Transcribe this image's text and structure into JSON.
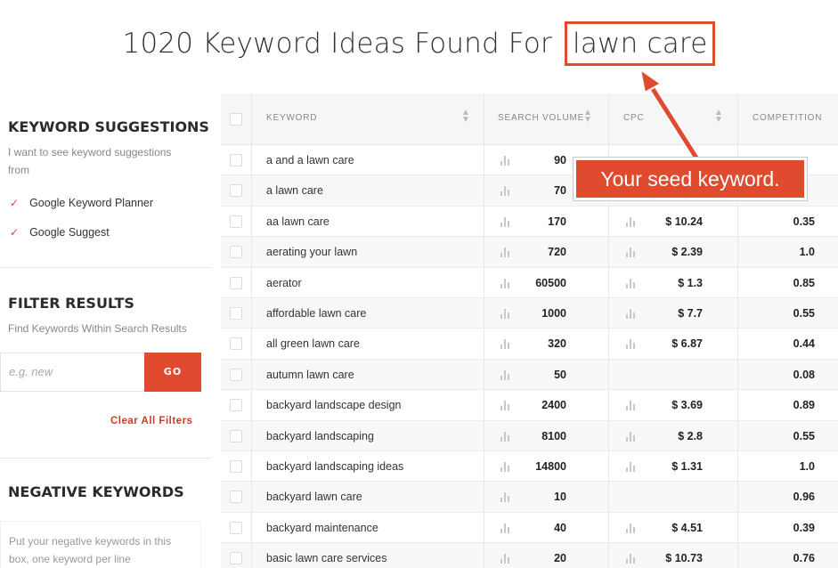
{
  "title": {
    "prefix": "1020 Keyword Ideas Found For",
    "seed": "lawn care"
  },
  "callout": {
    "text": "Your seed keyword."
  },
  "sidebar": {
    "suggestions": {
      "heading": "KEYWORD SUGGESTIONS",
      "description": "I want to see keyword suggestions from",
      "sources": [
        {
          "label": "Google Keyword Planner",
          "checked": true
        },
        {
          "label": "Google Suggest",
          "checked": true
        }
      ]
    },
    "filter": {
      "heading": "FILTER RESULTS",
      "description": "Find Keywords Within Search Results",
      "placeholder": "e.g. new",
      "go_label": "GO",
      "clear_label": "Clear All Filters"
    },
    "negative": {
      "heading": "NEGATIVE KEYWORDS",
      "placeholder": "Put your negative keywords in this box, one keyword per line"
    }
  },
  "table": {
    "headers": {
      "keyword": "KEYWORD",
      "volume": "SEARCH VOLUME",
      "cpc": "CPC",
      "competition": "COMPETITION"
    },
    "rows": [
      {
        "keyword": "a and a lawn care",
        "volume": "90",
        "cpc": "",
        "competition": ""
      },
      {
        "keyword": "a lawn care",
        "volume": "70",
        "cpc": "",
        "competition": ""
      },
      {
        "keyword": "aa lawn care",
        "volume": "170",
        "cpc": "$ 10.24",
        "competition": "0.35"
      },
      {
        "keyword": "aerating your lawn",
        "volume": "720",
        "cpc": "$ 2.39",
        "competition": "1.0"
      },
      {
        "keyword": "aerator",
        "volume": "60500",
        "cpc": "$ 1.3",
        "competition": "0.85"
      },
      {
        "keyword": "affordable lawn care",
        "volume": "1000",
        "cpc": "$ 7.7",
        "competition": "0.55"
      },
      {
        "keyword": "all green lawn care",
        "volume": "320",
        "cpc": "$ 6.87",
        "competition": "0.44"
      },
      {
        "keyword": "autumn lawn care",
        "volume": "50",
        "cpc": "",
        "competition": "0.08"
      },
      {
        "keyword": "backyard landscape design",
        "volume": "2400",
        "cpc": "$ 3.69",
        "competition": "0.89"
      },
      {
        "keyword": "backyard landscaping",
        "volume": "8100",
        "cpc": "$ 2.8",
        "competition": "0.55"
      },
      {
        "keyword": "backyard landscaping ideas",
        "volume": "14800",
        "cpc": "$ 1.31",
        "competition": "1.0"
      },
      {
        "keyword": "backyard lawn care",
        "volume": "10",
        "cpc": "",
        "competition": "0.96"
      },
      {
        "keyword": "backyard maintenance",
        "volume": "40",
        "cpc": "$ 4.51",
        "competition": "0.39"
      },
      {
        "keyword": "basic lawn care services",
        "volume": "20",
        "cpc": "$ 10.73",
        "competition": "0.76"
      }
    ]
  },
  "colors": {
    "accent": "#e04a2f"
  }
}
